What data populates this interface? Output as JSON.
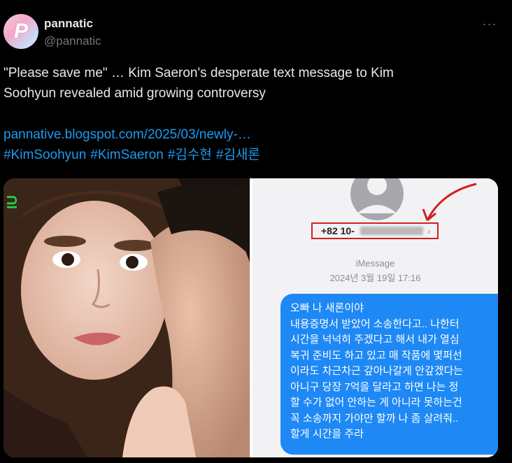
{
  "tweet": {
    "avatar_icon": "pannatic-logo",
    "display_name": "pannatic",
    "handle": "@pannatic",
    "more_icon": "more-options-icon",
    "more_glyph": "···",
    "text": "\"Please save me\" … Kim Saeron's desperate text message to Kim\nSoohyun revealed amid growing controversy",
    "link": "pannative.blogspot.com/2025/03/newly-…",
    "hashtags": [
      "#KimSoohyun",
      "#KimSaeron",
      "#김수현",
      "#김새론"
    ]
  },
  "media": {
    "left_photo_watermark": "IU",
    "screenshot": {
      "phone_number": "+82 10-",
      "service_label": "iMessage",
      "date": "2024년 3월 19일 17:16",
      "message_lines": [
        "오빠 나 새론이야",
        "내용증명서 받았어 소송한다고.. 나한터",
        "시간을 넉넉히 주겠다고 해서 내가 열심",
        "복귀 준비도 하고 있고 매 작품에 몇퍼선",
        "이라도 차근차근 갚아나갈게 안갚겠다는",
        "아니구 당장 7억을 달라고 하면 나는 정",
        "할 수가 없어 안하는 게 아니라 못하는건",
        "꼭 소송까지 가야만 할까 나 좀 살려줘..",
        "할게 시간을 주라"
      ]
    }
  },
  "colors": {
    "background": "#000000",
    "text": "#e7e9ea",
    "secondary": "#71767b",
    "link": "#1d9bf0",
    "bubble": "#1e88f5",
    "highlight_box": "#d21f1f"
  }
}
